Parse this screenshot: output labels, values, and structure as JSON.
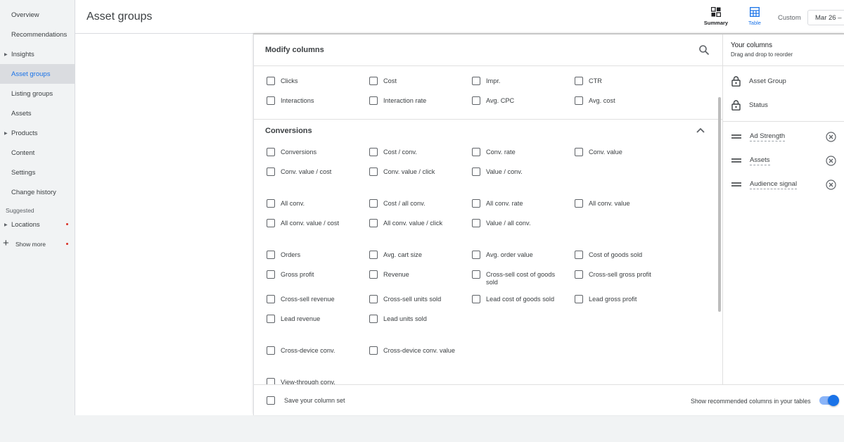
{
  "sidebar": {
    "items": [
      {
        "label": "Overview"
      },
      {
        "label": "Recommendations"
      },
      {
        "label": "Insights"
      },
      {
        "label": "Asset groups"
      },
      {
        "label": "Listing groups"
      },
      {
        "label": "Assets"
      },
      {
        "label": "Products"
      },
      {
        "label": "Content"
      },
      {
        "label": "Settings"
      },
      {
        "label": "Change history"
      }
    ],
    "suggested_label": "Suggested",
    "suggested_items": [
      {
        "label": "Locations"
      }
    ],
    "show_more_label": "Show more",
    "active_item": "Asset groups"
  },
  "header": {
    "title": "Asset groups",
    "summary_label": "Summary",
    "table_label": "Table",
    "custom_label": "Custom",
    "date_value": "Mar 26 –"
  },
  "modify": {
    "title": "Modify columns",
    "performance": [
      "Clicks",
      "Cost",
      "Impr.",
      "CTR",
      "Interactions",
      "Interaction rate",
      "Avg. CPC",
      "Avg. cost"
    ],
    "conversions_title": "Conversions",
    "conversions": [
      "Conversions",
      "Cost / conv.",
      "Conv. rate",
      "Conv. value",
      "Conv. value / cost",
      "Conv. value / click",
      "Value / conv.",
      "All conv.",
      "Cost / all conv.",
      "All conv. rate",
      "All conv. value",
      "All conv. value / cost",
      "All conv. value / click",
      "Value / all conv.",
      "Orders",
      "Avg. cart size",
      "Avg. order value",
      "Cost of goods sold",
      "Gross profit",
      "Revenue",
      "Cross-sell cost of goods sold",
      "Cross-sell gross profit",
      "Cross-sell revenue",
      "Cross-sell units sold",
      "Lead cost of goods sold",
      "Lead gross profit",
      "Lead revenue",
      "Lead units sold",
      "Cross-device conv.",
      "Cross-device conv. value",
      "View-through conv."
    ],
    "save_label": "Save your column set",
    "recommended_label": "Show recommended columns in your tables",
    "recommended_on": true
  },
  "your_columns": {
    "title": "Your columns",
    "subtitle": "Drag and drop to reorder",
    "locked": [
      "Asset Group",
      "Status"
    ],
    "movable": [
      "Ad Strength",
      "Assets",
      "Audience signal"
    ]
  },
  "colors": {
    "accent": "#1a73e8",
    "sidebar_bg": "#f1f3f4",
    "active_bg": "#dadce0",
    "badge": "#d93025"
  }
}
